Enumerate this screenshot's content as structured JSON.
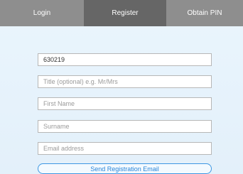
{
  "tabs": {
    "login": "Login",
    "register": "Register",
    "obtain_pin": "Obtain PIN"
  },
  "form": {
    "code": {
      "value": "630219"
    },
    "title": {
      "placeholder": "Title (optional) e.g. Mr/Mrs"
    },
    "first_name": {
      "placeholder": "First Name"
    },
    "surname": {
      "placeholder": "Surname"
    },
    "email": {
      "placeholder": "Email address"
    },
    "submit_label": "Send Registration Email"
  },
  "colors": {
    "active_tab": "#666666",
    "inactive_tab": "#8e8e8e",
    "accent": "#2a86d8"
  }
}
